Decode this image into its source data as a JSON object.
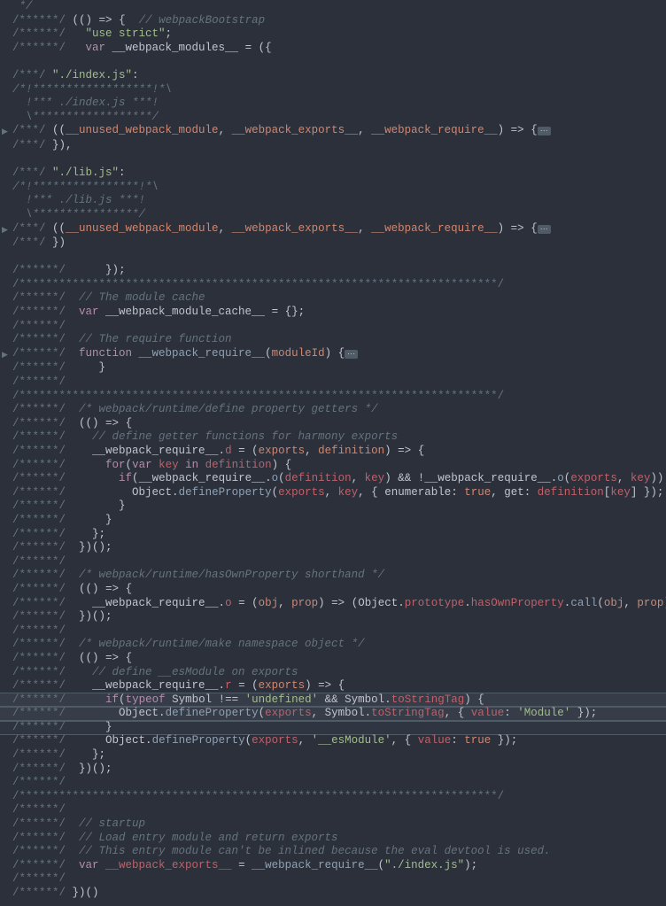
{
  "lines": {
    "l1": " */",
    "l2_comment": "/******/ ",
    "l2_punct1": "(",
    "l2_punct2": "()",
    "l2_arrow": " => ",
    "l2_brace": "{",
    "l2_c2": "  // webpackBootstrap",
    "l3_c": "/******/   ",
    "l3_str": "\"use strict\"",
    "l3_semi": ";",
    "l4_c": "/******/   ",
    "l4_var": "var",
    "l4_id": " __webpack_modules__ ",
    "l4_eq": "= ",
    "l4_p1": "(",
    "l4_p2": "{",
    "l5_empty": "",
    "l6_c": "/***/ ",
    "l6_str": "\"./index.js\"",
    "l6_colon": ":",
    "l7": "/*!******************!*\\",
    "l8": "  !*** ./index.js ***!",
    "l9": "  \\******************/",
    "l10_c": "/***/ ",
    "l10_p1": "((",
    "l10_id1": "__unused_webpack_module",
    "l10_co1": ", ",
    "l10_id2": "__webpack_exports__",
    "l10_co2": ", ",
    "l10_id3": "__webpack_require__",
    "l10_p2": ")",
    "l10_arrow": " => ",
    "l10_brace": "{",
    "l10_fold": "⋯",
    "l11_c": "/***/ ",
    "l11_b1": "}",
    "l11_b2": ")",
    "l11_co": ",",
    "l12_empty": "",
    "l13_c": "/***/ ",
    "l13_str": "\"./lib.js\"",
    "l13_colon": ":",
    "l14": "/*!****************!*\\",
    "l15": "  !*** ./lib.js ***!",
    "l16": "  \\****************/",
    "l17_c": "/***/ ",
    "l17_p1": "((",
    "l17_id1": "__unused_webpack_module",
    "l17_co1": ", ",
    "l17_id2": "__webpack_exports__",
    "l17_co2": ", ",
    "l17_id3": "__webpack_require__",
    "l17_p2": ")",
    "l17_arrow": " => ",
    "l17_brace": "{",
    "l17_fold": "⋯",
    "l18_c": "/***/ ",
    "l18_b1": "}",
    "l18_b2": ")",
    "l19_empty": "",
    "l20_c": "/******/      ",
    "l20_b1": "}",
    "l20_b2": ")",
    "l20_semi": ";",
    "l21": "/************************************************************************/",
    "l22_c": "/******/  ",
    "l22_c2": "// The module cache",
    "l23_c": "/******/  ",
    "l23_var": "var",
    "l23_id": " __webpack_module_cache__ ",
    "l23_eq": "= ",
    "l23_braces": "{}",
    "l23_semi": ";",
    "l24_c": "/******/",
    "l25_c": "/******/  ",
    "l25_c2": "// The require function",
    "l26_c": "/******/  ",
    "l26_func": "function",
    "l26_name": " __webpack_require__",
    "l26_p1": "(",
    "l26_param": "moduleId",
    "l26_p2": ")",
    "l26_brace": " {",
    "l26_fold": "⋯",
    "l27_c": "/******/     ",
    "l27_brace": "}",
    "l28_c": "/******/",
    "l29": "/************************************************************************/",
    "l30_c": "/******/  ",
    "l30_c2": "/* webpack/runtime/define property getters */",
    "l31_c": "/******/  ",
    "l31_p1": "(",
    "l31_p2": "()",
    "l31_arrow": " => ",
    "l31_brace": "{",
    "l32_c": "/******/    ",
    "l32_c2": "// define getter functions for harmony exports",
    "l33_c": "/******/    ",
    "l33_id": "__webpack_require__",
    "l33_dot": ".",
    "l33_prop": "d",
    "l33_eq": " = ",
    "l33_p1": "(",
    "l33_a1": "exports",
    "l33_co": ", ",
    "l33_a2": "definition",
    "l33_p2": ")",
    "l33_arrow": " => ",
    "l33_brace": "{",
    "l34_c": "/******/      ",
    "l34_for": "for",
    "l34_p1": "(",
    "l34_varkw": "var",
    "l34_v": " key ",
    "l34_in": "in",
    "l34_id": " definition",
    "l34_p2": ")",
    "l34_brace": " {",
    "l35_c": "/******/        ",
    "l35_if": "if",
    "l35_p1": "(",
    "l35_id1": "__webpack_require__",
    "l35_dot1": ".",
    "l35_m1": "o",
    "l35_p2": "(",
    "l35_a1": "definition",
    "l35_co1": ", ",
    "l35_a2": "key",
    "l35_p3": ")",
    "l35_and": " && ",
    "l35_not": "!",
    "l35_id2": "__webpack_require__",
    "l35_dot2": ".",
    "l35_m2": "o",
    "l35_p4": "(",
    "l35_a3": "exports",
    "l35_co2": ", ",
    "l35_a4": "key",
    "l35_p5": "))",
    "l35_brace": " {",
    "l36_c": "/******/          ",
    "l36_obj": "Object",
    "l36_dot": ".",
    "l36_m": "defineProperty",
    "l36_p1": "(",
    "l36_a1": "exports",
    "l36_co1": ", ",
    "l36_a2": "key",
    "l36_co2": ", ",
    "l36_brace1": "{ ",
    "l36_k1": "enumerable",
    "l36_col1": ": ",
    "l36_v1": "true",
    "l36_co3": ", ",
    "l36_k2": "get",
    "l36_col2": ": ",
    "l36_v2": "definition",
    "l36_br1": "[",
    "l36_idx": "key",
    "l36_br2": "]",
    "l36_brace2": " }",
    "l36_p2": ");",
    "l37_c": "/******/        ",
    "l37_brace": "}",
    "l38_c": "/******/      ",
    "l38_brace": "}",
    "l39_c": "/******/    ",
    "l39_brace": "}",
    "l39_semi": ";",
    "l40_c": "/******/  ",
    "l40_b1": "}",
    "l40_b2": ")",
    "l40_call": "();",
    "l41_c": "/******/",
    "l42_c": "/******/  ",
    "l42_c2": "/* webpack/runtime/hasOwnProperty shorthand */",
    "l43_c": "/******/  ",
    "l43_p1": "(",
    "l43_p2": "()",
    "l43_arrow": " => ",
    "l43_brace": "{",
    "l44_c": "/******/    ",
    "l44_id": "__webpack_require__",
    "l44_dot": ".",
    "l44_prop": "o",
    "l44_eq": " = ",
    "l44_p1": "(",
    "l44_a1": "obj",
    "l44_co1": ", ",
    "l44_a2": "prop",
    "l44_p2": ")",
    "l44_arrow": " => ",
    "l44_p3": "(",
    "l44_obj": "Object",
    "l44_dot2": ".",
    "l44_m1": "prototype",
    "l44_dot3": ".",
    "l44_m2": "hasOwnProperty",
    "l44_dot4": ".",
    "l44_m3": "call",
    "l44_p4": "(",
    "l44_a3": "obj",
    "l44_co2": ", ",
    "l44_a4": "prop",
    "l44_p5": "))",
    "l45_c": "/******/  ",
    "l45_b1": "}",
    "l45_b2": ")",
    "l45_call": "();",
    "l46_c": "/******/",
    "l47_c": "/******/  ",
    "l47_c2": "/* webpack/runtime/make namespace object */",
    "l48_c": "/******/  ",
    "l48_p1": "(",
    "l48_p2": "()",
    "l48_arrow": " => ",
    "l48_brace": "{",
    "l49_c": "/******/    ",
    "l49_c2": "// define __esModule on exports",
    "l50_c": "/******/    ",
    "l50_id": "__webpack_require__",
    "l50_dot": ".",
    "l50_prop": "r",
    "l50_eq": " = ",
    "l50_p1": "(",
    "l50_a1": "exports",
    "l50_p2": ")",
    "l50_arrow": " => ",
    "l50_brace": "{",
    "l51_c": "/******/      ",
    "l51_if": "if",
    "l51_p1": "(",
    "l51_typeof": "typeof",
    "l51_sym": " Symbol ",
    "l51_neq": "!==",
    "l51_str": " 'undefined' ",
    "l51_and": "&&",
    "l51_sym2": " Symbol",
    "l51_dot": ".",
    "l51_m": "toStringTag",
    "l51_p2": ")",
    "l51_brace": " {",
    "l52_c": "/******/        ",
    "l52_obj": "Object",
    "l52_dot": ".",
    "l52_m": "defineProperty",
    "l52_p1": "(",
    "l52_a1": "exports",
    "l52_co1": ", ",
    "l52_sym": "Symbol",
    "l52_dot2": ".",
    "l52_m2": "toStringTag",
    "l52_co2": ", ",
    "l52_brace1": "{ ",
    "l52_k": "value",
    "l52_col": ": ",
    "l52_v": "'Module'",
    "l52_brace2": " }",
    "l52_p2": ");",
    "l53_c": "/******/      ",
    "l53_brace": "}",
    "l54_c": "/******/      ",
    "l54_obj": "Object",
    "l54_dot": ".",
    "l54_m": "defineProperty",
    "l54_p1": "(",
    "l54_a1": "exports",
    "l54_co1": ", ",
    "l54_str": "'__esModule'",
    "l54_co2": ", ",
    "l54_brace1": "{ ",
    "l54_k": "value",
    "l54_col": ": ",
    "l54_v": "true",
    "l54_brace2": " }",
    "l54_p2": ");",
    "l55_c": "/******/    ",
    "l55_brace": "}",
    "l55_semi": ";",
    "l56_c": "/******/  ",
    "l56_b1": "}",
    "l56_b2": ")",
    "l56_call": "();",
    "l57_c": "/******/",
    "l58": "/************************************************************************/",
    "l59_c": "/******/",
    "l60_c": "/******/  ",
    "l60_c2": "// startup",
    "l61_c": "/******/  ",
    "l61_c2": "// Load entry module and return exports",
    "l62_c": "/******/  ",
    "l62_c2": "// This entry module can't be inlined because the eval devtool is used.",
    "l63_c": "/******/  ",
    "l63_var": "var",
    "l63_id": " __webpack_exports__ ",
    "l63_eq": "= ",
    "l63_fn": "__webpack_require__",
    "l63_p1": "(",
    "l63_str": "\"./index.js\"",
    "l63_p2": ");",
    "l64_c": "/******/",
    "l65_c": "/******/ ",
    "l65_b1": "}",
    "l65_b2": ")",
    "l65_call": "()"
  }
}
